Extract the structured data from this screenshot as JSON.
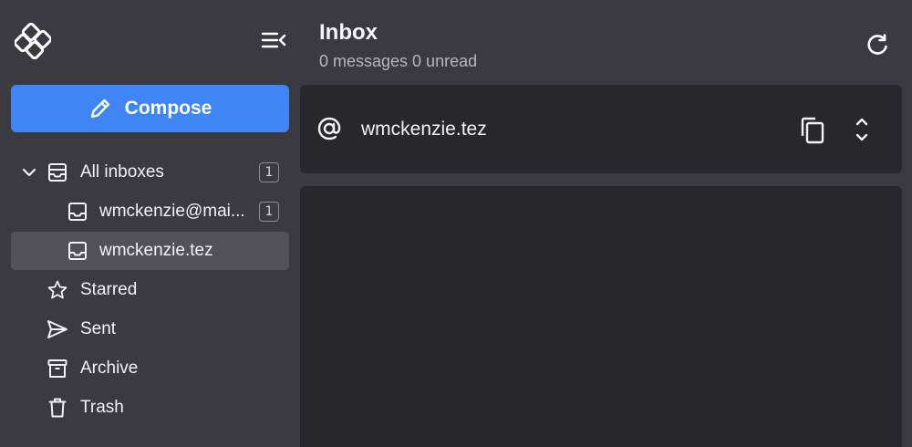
{
  "sidebar": {
    "compose_label": "Compose",
    "items": [
      {
        "label": "All inboxes",
        "badge": "1"
      },
      {
        "label": "wmckenzie@mai...",
        "badge": "1"
      },
      {
        "label": "wmckenzie.tez"
      },
      {
        "label": "Starred"
      },
      {
        "label": "Sent"
      },
      {
        "label": "Archive"
      },
      {
        "label": "Trash"
      }
    ]
  },
  "main": {
    "title": "Inbox",
    "subtitle": "0 messages 0 unread",
    "address": "wmckenzie.tez"
  },
  "colors": {
    "accent": "#3f85f4",
    "background": "#3b3a41",
    "panel": "#28272c",
    "active_item": "#52515a"
  },
  "icons": {
    "logo": "logo-icon",
    "collapse": "collapse-sidebar-icon",
    "compose": "pencil-icon",
    "refresh": "refresh-icon",
    "at": "at-icon",
    "copy": "copy-icon",
    "expand": "expand-icon"
  }
}
